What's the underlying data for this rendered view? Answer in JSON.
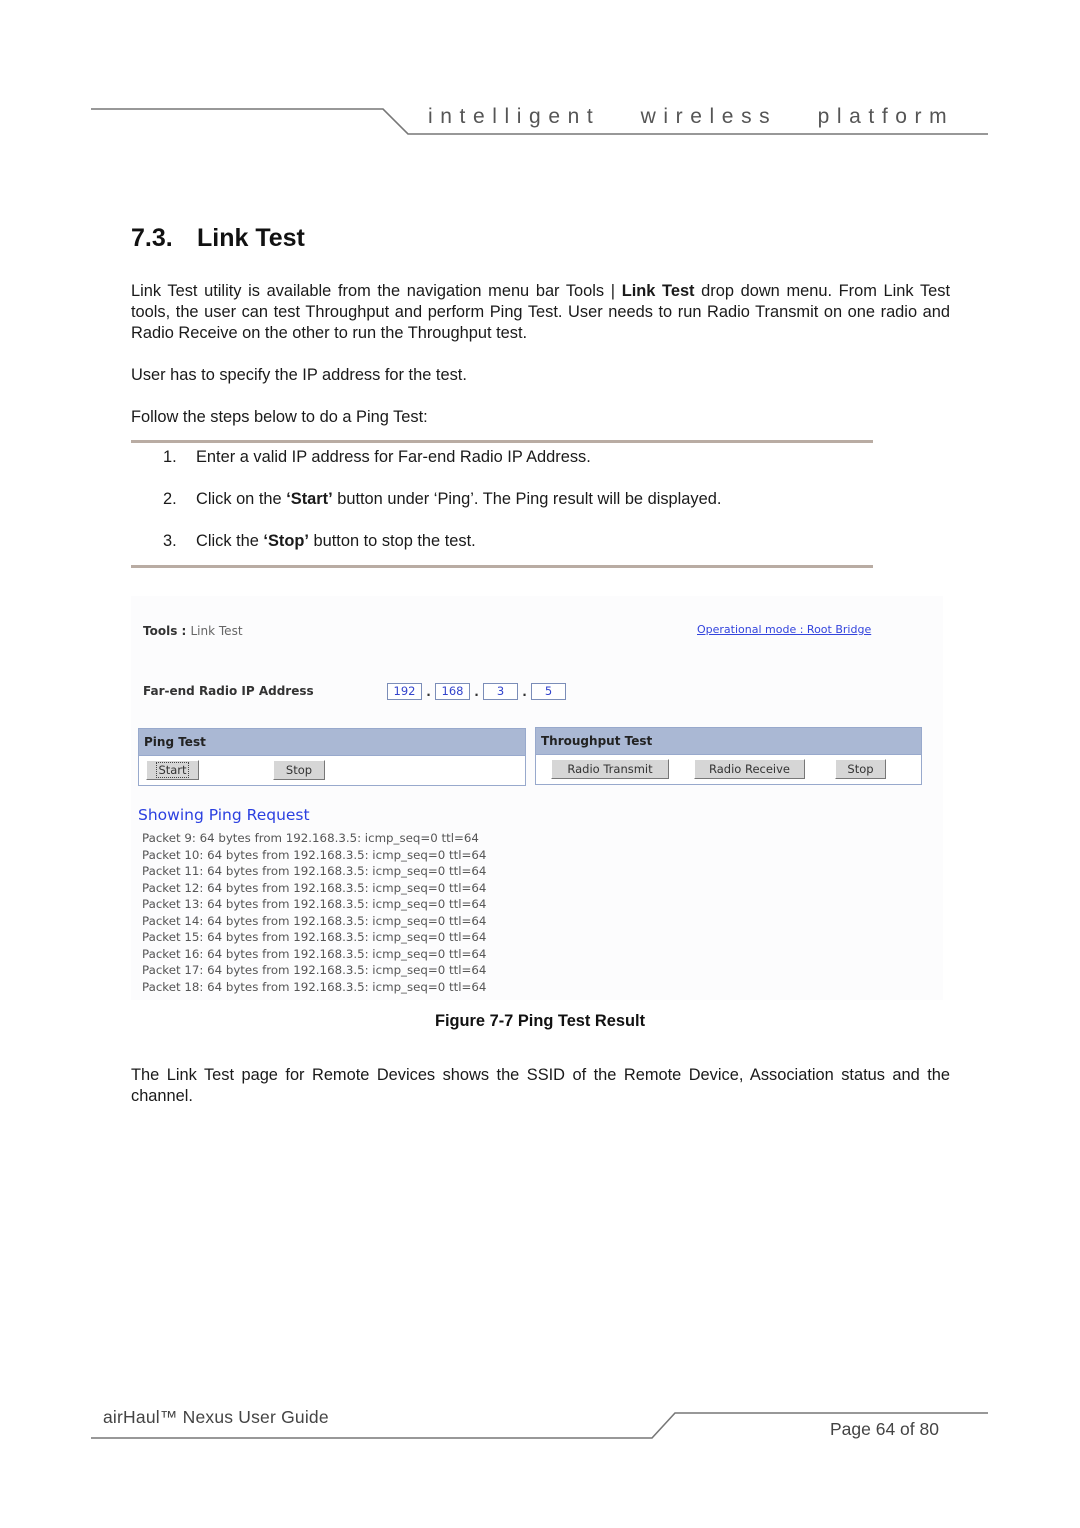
{
  "header": {
    "tagline": "intelligent   wireless   platform"
  },
  "section": {
    "number": "7.3.",
    "title": "Link Test"
  },
  "intro": {
    "p1_a": "Link Test utility is available from the navigation menu bar Tools | ",
    "p1_bold": "Link Test",
    "p1_b": " drop down menu. From Link Test tools, the user can test Throughput and perform Ping Test.  User needs to run Radio Transmit on one radio and Radio Receive on the other to run the Throughput test.",
    "p2": "User has to specify the IP address for the test.",
    "p3": "Follow the steps below to do a Ping Test:"
  },
  "steps": [
    {
      "num": "1.",
      "pre": "Enter a valid IP address for Far-end Radio IP Address.",
      "bold": "",
      "post": ""
    },
    {
      "num": "2.",
      "pre": "Click on the ",
      "bold": "‘Start’",
      "post": " button under ‘Ping’. The Ping result will be displayed."
    },
    {
      "num": "3.",
      "pre": "Click the ",
      "bold": "‘Stop’",
      "post": " button to stop the test."
    }
  ],
  "figure": {
    "tools_label": "Tools :",
    "tools_crumb": "Link Test",
    "operational_mode_link": "Operational mode : Root Bridge",
    "ip_label": "Far-end Radio IP Address",
    "ip_octets": [
      "192",
      "168",
      "3",
      "5"
    ],
    "ping_panel": {
      "title": "Ping Test",
      "start_label": "Start",
      "stop_label": "Stop"
    },
    "throughput_panel": {
      "title": "Throughput Test",
      "transmit_label": "Radio Transmit",
      "receive_label": "Radio Receive",
      "stop_label": "Stop"
    },
    "showing_title": "Showing Ping Request",
    "ping_lines": [
      "Packet 9: 64 bytes from 192.168.3.5: icmp_seq=0 ttl=64",
      "Packet 10: 64 bytes from 192.168.3.5: icmp_seq=0 ttl=64",
      "Packet 11: 64 bytes from 192.168.3.5: icmp_seq=0 ttl=64",
      "Packet 12: 64 bytes from 192.168.3.5: icmp_seq=0 ttl=64",
      "Packet 13: 64 bytes from 192.168.3.5: icmp_seq=0 ttl=64",
      "Packet 14: 64 bytes from 192.168.3.5: icmp_seq=0 ttl=64",
      "Packet 15: 64 bytes from 192.168.3.5: icmp_seq=0 ttl=64",
      "Packet 16: 64 bytes from 192.168.3.5: icmp_seq=0 ttl=64",
      "Packet 17: 64 bytes from 192.168.3.5: icmp_seq=0 ttl=64",
      "Packet 18: 64 bytes from 192.168.3.5: icmp_seq=0 ttl=64"
    ]
  },
  "caption": "Figure 7-7 Ping Test Result",
  "outro": "The Link Test page for Remote Devices shows the SSID of the Remote Device, Association status and the channel.",
  "footer": {
    "guide_title": "airHaul™ Nexus User Guide",
    "page_label": "Page 64 of 80"
  }
}
